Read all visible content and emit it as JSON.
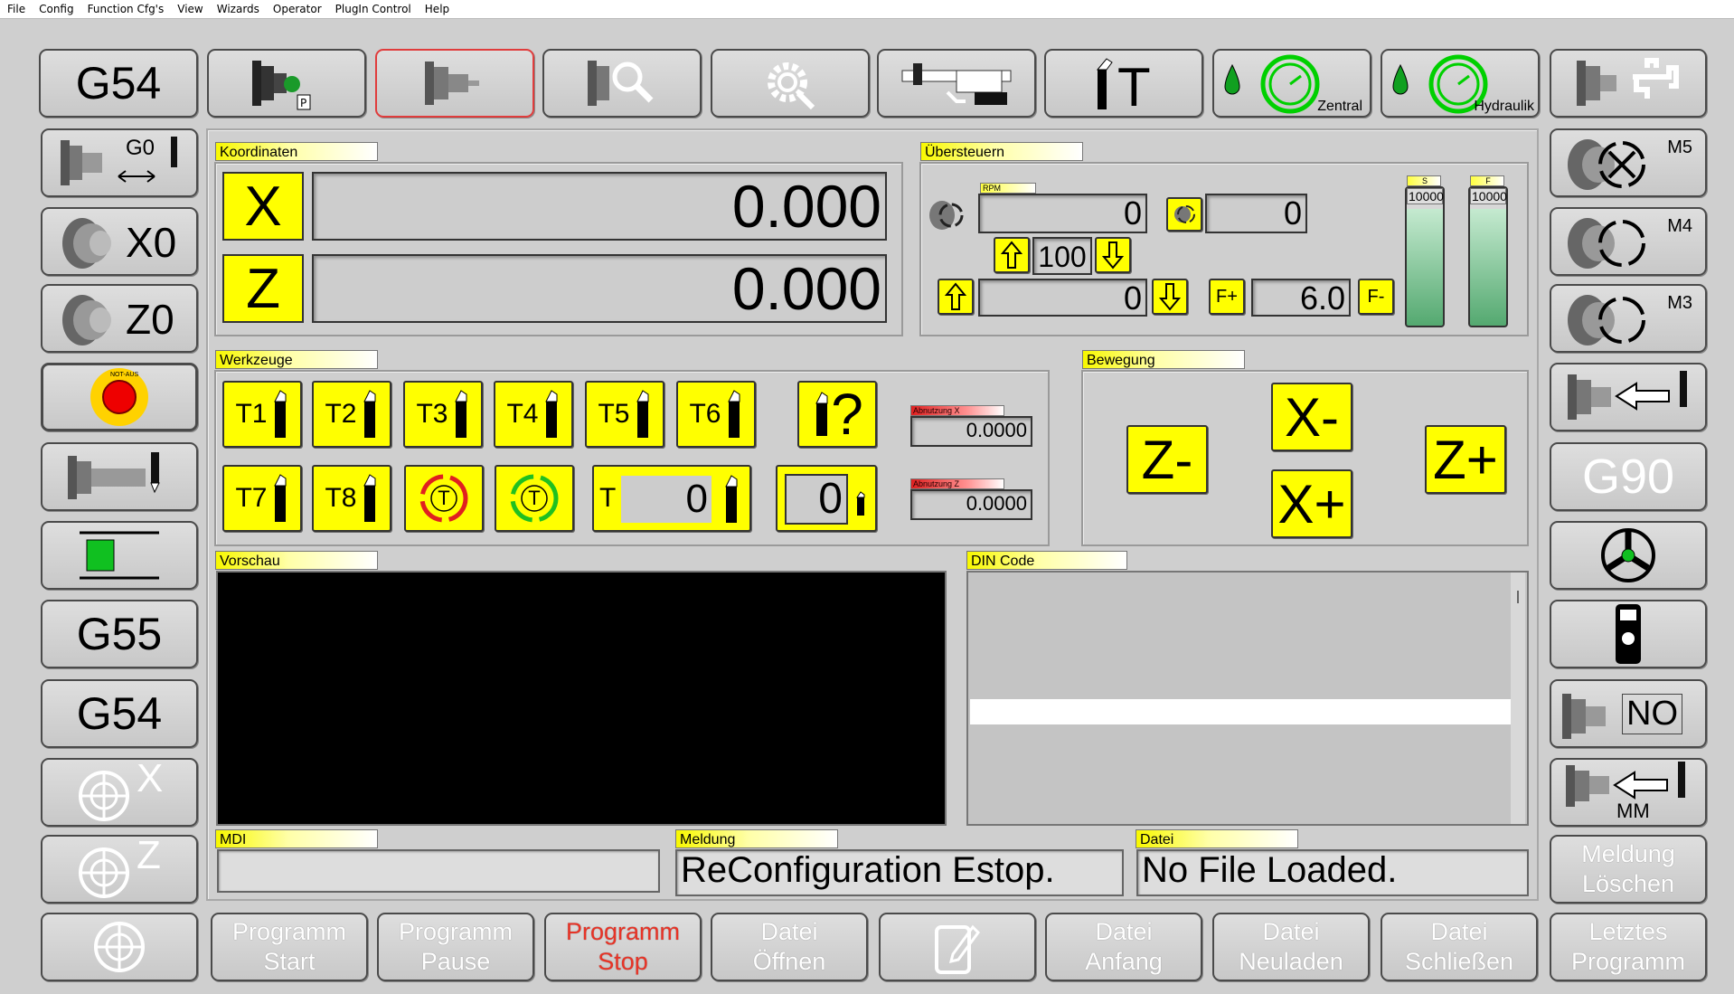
{
  "menu": [
    "File",
    "Config",
    "Function Cfg's",
    "View",
    "Wizards",
    "Operator",
    "PlugIn Control",
    "Help"
  ],
  "top_buttons": {
    "g54": "G54",
    "zentral_label": "Zentral",
    "hydraulik_label": "Hydraulik"
  },
  "left_buttons": {
    "g0_label": "G0",
    "x0_label": "X0",
    "z0_label": "Z0",
    "estop_text": "NOT-AUS",
    "g55": "G55",
    "g54": "G54",
    "x_label": "X",
    "z_label": "Z"
  },
  "right_buttons": {
    "m5": "M5",
    "m4": "M4",
    "m3": "M3",
    "g90": "G90",
    "no_label": "NO",
    "mm_label": "MM",
    "meldung_loeschen": "Meldung Löschen",
    "letztes_programm": "Letztes Programm"
  },
  "bottom_buttons": {
    "programm_start": "Programm Start",
    "programm_pause": "Programm Pause",
    "programm_stop": "Programm Stop",
    "datei_oeffnen": "Datei Öffnen",
    "datei_anfang": "Datei Anfang",
    "datei_neuladen": "Datei Neuladen",
    "datei_schliessen": "Datei Schließen"
  },
  "koordinaten": {
    "title": "Koordinaten",
    "x_label": "X",
    "x_value": "0.000",
    "z_label": "Z",
    "z_value": "0.000"
  },
  "uebersteuern": {
    "title": "Übersteuern",
    "rpm_label": "RPM",
    "rpm_value": "0",
    "spindle_value": "0",
    "spindle_override": "100",
    "feed_value": "0",
    "f_plus": "F+",
    "f_minus": "F-",
    "feed_override": "6.0",
    "s_label": "S",
    "f_label": "F",
    "s_bar_value": "10000",
    "f_bar_value": "10000",
    "s_level": 0.85,
    "f_level": 0.85
  },
  "werkzeuge": {
    "title": "Werkzeuge",
    "tools": [
      "T1",
      "T2",
      "T3",
      "T4",
      "T5",
      "T6",
      "T7",
      "T8"
    ],
    "unknown_tool": "?",
    "rotate_label": "T",
    "t_label": "T",
    "t_value": "0",
    "tool_value": "0",
    "abnutzung_x_label": "Abnutzung X",
    "abnutzung_x_value": "0.0000",
    "abnutzung_z_label": "Abnutzung Z",
    "abnutzung_z_value": "0.0000"
  },
  "bewegung": {
    "title": "Bewegung",
    "z_minus": "Z-",
    "x_minus": "X-",
    "x_plus": "X+",
    "z_plus": "Z+"
  },
  "vorschau": {
    "title": "Vorschau"
  },
  "din_code": {
    "title": "DIN Code"
  },
  "mdi": {
    "title": "MDI",
    "value": ""
  },
  "meldung": {
    "title": "Meldung",
    "value": "ReConfiguration Estop."
  },
  "datei": {
    "title": "Datei",
    "value": "No File Loaded."
  },
  "colors": {
    "panel_bg": "#cfcfcf",
    "yellow": "#ffff00",
    "gauge_green": "#00c020",
    "stop_red": "#e83326"
  }
}
